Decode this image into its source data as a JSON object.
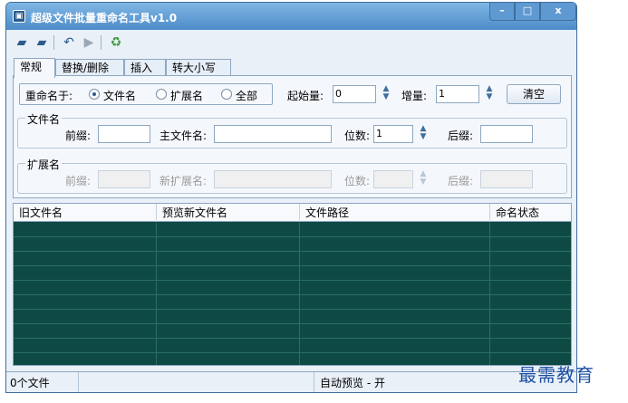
{
  "window": {
    "title": "超级文件批量重命名工具v1.0",
    "controls": {
      "minimize": "–",
      "maximize": "□",
      "close": "x"
    }
  },
  "toolbar": {
    "icons": [
      "open-folder-icon",
      "open-files-icon",
      "undo-icon",
      "play-icon",
      "refresh-icon"
    ]
  },
  "tabs": [
    "常规",
    "替换/删除",
    "插入",
    "转大小写"
  ],
  "rename": {
    "label": "重命名于:",
    "options": [
      {
        "label": "文件名",
        "selected": true
      },
      {
        "label": "扩展名",
        "selected": false
      },
      {
        "label": "全部",
        "selected": false
      }
    ],
    "start_label": "起始量:",
    "start_value": "0",
    "step_label": "增量:",
    "step_value": "1",
    "clear_button": "清空"
  },
  "filename_group": {
    "title": "文件名",
    "prefix_label": "前缀:",
    "prefix_value": "",
    "main_label": "主文件名:",
    "main_value": "",
    "digits_label": "位数:",
    "digits_value": "1",
    "suffix_label": "后缀:",
    "suffix_value": ""
  },
  "ext_group": {
    "title": "扩展名",
    "prefix_label": "前缀:",
    "prefix_value": "",
    "new_ext_label": "新扩展名:",
    "new_ext_value": "",
    "digits_label": "位数:",
    "digits_value": "",
    "suffix_label": "后缀:",
    "suffix_value": ""
  },
  "table": {
    "columns": [
      "旧文件名",
      "预览新文件名",
      "文件路径",
      "命名状态"
    ],
    "row_count_visible": 11
  },
  "status": {
    "file_count": "0个文件",
    "middle": "",
    "preview": "自动预览 - 开"
  },
  "watermark": "最需教育",
  "colors": {
    "grid_bg": "#0e4a43",
    "title_bg": "#4e8cc9",
    "window_bg": "#c9ddf0"
  }
}
